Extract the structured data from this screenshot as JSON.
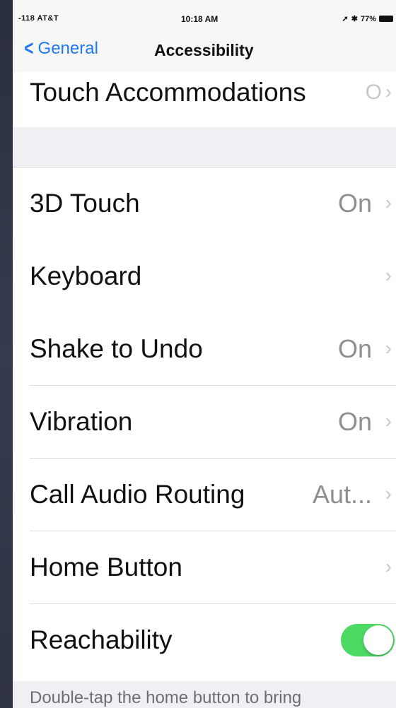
{
  "status_bar": {
    "carrier": "-118 AT&T",
    "wifi_icon": "wifi-icon",
    "time": "10:18 AM",
    "right": "77%"
  },
  "nav": {
    "back_label": "General",
    "title": "Accessibility"
  },
  "top_row": {
    "label": "Touch Accommodations",
    "value": "O"
  },
  "rows": [
    {
      "label": "3D Touch",
      "value": "On"
    },
    {
      "label": "Keyboard",
      "value": ""
    },
    {
      "label": "Shake to Undo",
      "value": "On"
    },
    {
      "label": "Vibration",
      "value": "On"
    },
    {
      "label": "Call Audio Routing",
      "value": "Aut..."
    },
    {
      "label": "Home Button",
      "value": ""
    },
    {
      "label": "Reachability",
      "toggle": true
    }
  ],
  "footer": {
    "text": "Double-tap the home button to bring"
  },
  "colors": {
    "accent": "#1f78f0",
    "toggle_on": "#4cd964"
  }
}
